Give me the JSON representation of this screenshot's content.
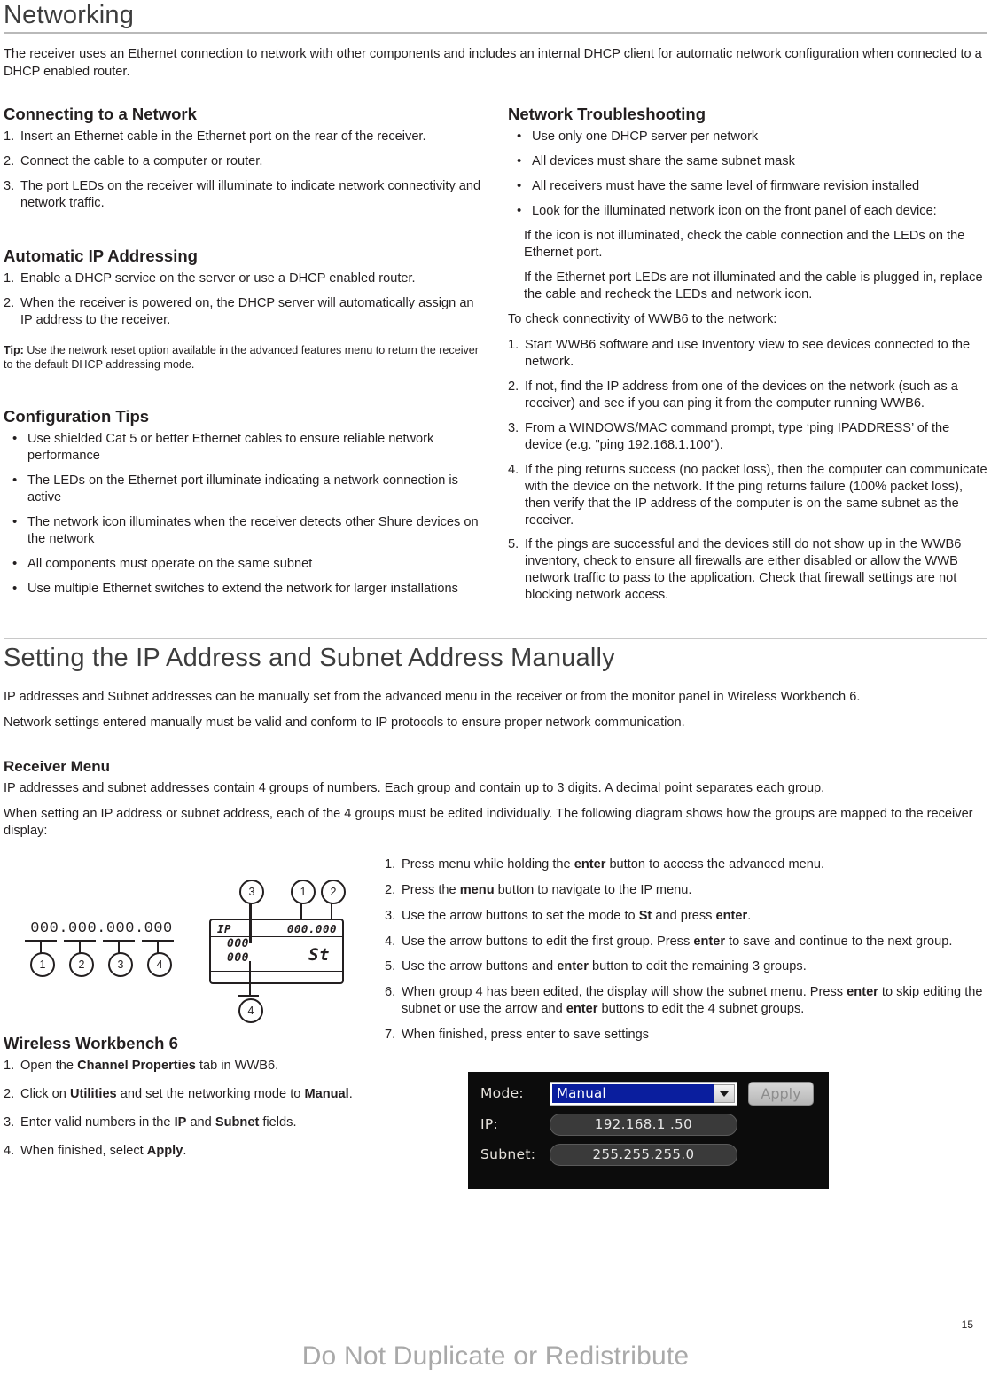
{
  "page": {
    "number": "15",
    "watermark": "Do Not Duplicate or Redistribute"
  },
  "section1": {
    "title": "Networking",
    "intro": "The receiver uses an Ethernet connection to network with other components and includes an internal DHCP client for automatic network configuration when connected to a DHCP enabled router.",
    "left": {
      "connecting": {
        "heading": "Connecting to a Network",
        "steps": [
          {
            "mark": "1.",
            "text": "Insert an Ethernet cable in the Ethernet port on the rear of the receiver."
          },
          {
            "mark": "2.",
            "text": "Connect the cable to a computer or router."
          },
          {
            "mark": "3.",
            "text": "The port LEDs on the receiver will illuminate to indicate network connectivity and network traffic."
          }
        ]
      },
      "auto_ip": {
        "heading": "Automatic IP Addressing",
        "steps": [
          {
            "mark": "1.",
            "text": "Enable a DHCP service on the server or use a DHCP enabled router."
          },
          {
            "mark": "2.",
            "text": "When the receiver is powered on, the DHCP server will automatically assign an IP address to the receiver."
          }
        ],
        "tip_label": "Tip:",
        "tip_text": "Use the network reset option available in the advanced features menu to return the receiver to the default DHCP addressing mode."
      },
      "config_tips": {
        "heading": "Configuration Tips",
        "bullets": [
          "Use shielded Cat 5 or better Ethernet cables to ensure reliable network performance",
          "The LEDs on the Ethernet port illuminate indicating a network connection is active",
          "The network icon illuminates when the receiver detects other Shure devices on the network",
          "All components must operate on the same subnet",
          "Use multiple Ethernet switches to extend the network for larger installations"
        ]
      }
    },
    "right": {
      "heading": "Network Troubleshooting",
      "bullets": [
        "Use only one DHCP server per network",
        "All devices must share the same subnet mask",
        "All receivers must have the same level of firmware revision installed",
        "Look for the illuminated network icon on the front panel of each device:"
      ],
      "notes": [
        "If the icon is not illuminated, check the cable connection and the LEDs on the Ethernet port.",
        "If the Ethernet port LEDs are not illuminated and the cable is plugged in, replace the cable and recheck the LEDs and network icon."
      ],
      "check_lead": "To check connectivity of WWB6 to the network:",
      "steps": [
        {
          "mark": "1.",
          "text": "Start WWB6 software and use Inventory view to see devices connected to the network."
        },
        {
          "mark": "2.",
          "text": "If not, find the IP address from one of the devices on the network (such as a receiver) and see if you can ping it from the computer running WWB6."
        },
        {
          "mark": "3.",
          "text": "From a WINDOWS/MAC command prompt, type ‘ping IPADDRESS’ of the device (e.g. \"ping 192.168.1.100\")."
        },
        {
          "mark": "4.",
          "text": "If the ping returns success (no packet loss), then the computer can communicate with the device on the network. If the ping returns failure (100% packet loss), then verify that the IP address of the computer is on the same subnet as the receiver."
        },
        {
          "mark": "5.",
          "text": "If the pings are successful and the devices still do not show up in the WWB6 inventory, check to ensure all firewalls are either disabled or allow the WWB network traffic to pass to the application. Check that firewall settings are not blocking network access."
        }
      ]
    }
  },
  "section2": {
    "title": "Setting the IP Address and Subnet Address Manually",
    "para1": "IP addresses and Subnet addresses can be manually set from the advanced menu in the receiver or from the monitor panel in Wireless Workbench 6.",
    "para2": "Network settings entered manually must be valid and conform to IP protocols to ensure proper network communication.",
    "receiver_menu": {
      "heading": " Receiver Menu",
      "para1": "IP addresses and subnet addresses contain 4 groups of numbers. Each group and contain up to 3 digits. A decimal point separates each group.",
      "para2": "When setting an IP address or subnet address, each of the 4 groups must be edited individually. The following diagram shows how the groups are mapped to the receiver display:"
    },
    "diagram": {
      "octets": "000.000.000.000",
      "group_labels": [
        "1",
        "2",
        "3",
        "4"
      ],
      "lcd": {
        "label_ip": "IP",
        "top_right": "000.000",
        "row1": "000",
        "row2": "000",
        "mode": "St"
      },
      "callouts": [
        "3",
        "1",
        "2",
        "4"
      ]
    },
    "steps": [
      {
        "mark": "1.",
        "pre": "Press menu while holding the ",
        "bold": "enter",
        "post": " button to access the advanced menu."
      },
      {
        "mark": "2.",
        "pre": "Press the ",
        "bold": "menu",
        "post": " button to navigate to the IP menu."
      },
      {
        "mark": "3.",
        "pre": "Use the arrow buttons to set the mode to ",
        "bold": "St",
        "post": " and press ",
        "bold2": "enter",
        "post2": "."
      },
      {
        "mark": "4.",
        "pre": "Use the arrow buttons to edit the first group. Press ",
        "bold": "enter",
        "post": " to save and continue to the next group."
      },
      {
        "mark": "5.",
        "pre": "Use the arrow buttons and ",
        "bold": "enter",
        "post": " button to edit the remaining 3 groups."
      },
      {
        "mark": "6.",
        "pre": "When group 4 has been edited, the display will show the subnet menu. Press ",
        "bold": "enter",
        "post": " to skip editing the subnet or use the arrow and ",
        "bold2": "enter",
        "post2": " buttons to edit the 4 subnet groups."
      },
      {
        "mark": "7.",
        "pre": "When finished, press enter to save settings",
        "bold": "",
        "post": ""
      }
    ]
  },
  "wwb6": {
    "heading": "Wireless Workbench 6",
    "steps": [
      {
        "mark": "1.",
        "pre": "Open the ",
        "bold": "Channel Properties",
        "post": " tab in WWB6."
      },
      {
        "mark": "2.",
        "pre": "Click on ",
        "bold": "Utilities",
        "post": " and set the networking mode to ",
        "bold2": "Manual",
        "post2": "."
      },
      {
        "mark": "3.",
        "pre": "Enter valid numbers in the ",
        "bold": "IP",
        "post": " and ",
        "bold2": "Subnet",
        "post2": " fields."
      },
      {
        "mark": "4.",
        "pre": "When finished, select ",
        "bold": "Apply",
        "post": "."
      }
    ],
    "screenshot": {
      "mode_label": "Mode:",
      "mode_value": "Manual",
      "apply_label": "Apply",
      "ip_label": "IP:",
      "ip_value": "192.168.1  .50",
      "subnet_label": "Subnet:",
      "subnet_value": "255.255.255.0"
    }
  },
  "colors": {
    "rule": "#b9b9b9",
    "text": "#231f20",
    "watermark": "#a9a9a9",
    "panel_bg": "#0c0c0c",
    "combo_select": "#0a1e9e"
  }
}
